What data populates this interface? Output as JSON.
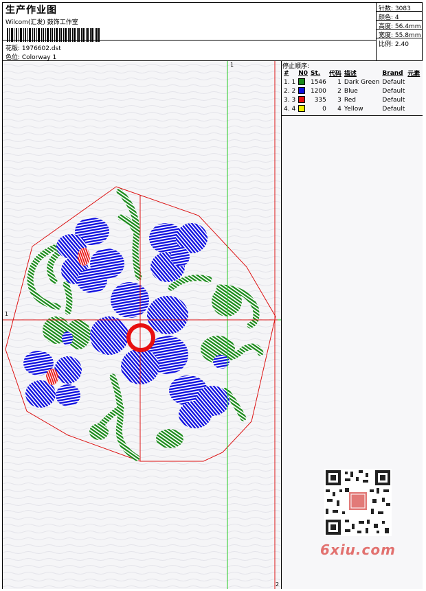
{
  "header": {
    "title": "生产作业图",
    "company": "Wilcom(汇发) 鼓饰工作室",
    "design_label": "花版: 1976602.dst",
    "colorway_label": "色位: Colorway 1"
  },
  "stats": [
    "针数: 3083",
    "颜色: 4",
    "高度: 56.4mm",
    "宽度: 55.8mm",
    "比例: 2.40"
  ],
  "stop_sequence": {
    "title": "停止顺序:",
    "columns": [
      "#",
      "N0",
      "St.",
      "代码",
      "描述",
      "Brand",
      "元素"
    ],
    "rows": [
      {
        "index": "1. 1",
        "color": "#1a8a1a",
        "stitches": "1546",
        "code": "1",
        "description": "Dark Green",
        "brand": "Default"
      },
      {
        "index": "2. 2",
        "color": "#1010e0",
        "stitches": "1200",
        "code": "2",
        "description": "Blue",
        "brand": "Default"
      },
      {
        "index": "3. 3",
        "color": "#e81010",
        "stitches": "335",
        "code": "3",
        "description": "Red",
        "brand": "Default"
      },
      {
        "index": "4. 4",
        "color": "#f0f000",
        "stitches": "0",
        "code": "4",
        "description": "Yellow",
        "brand": "Default"
      }
    ]
  },
  "guides": {
    "vertical_label": "1",
    "horizontal_label": "1",
    "vertical_red_label": "2"
  },
  "colors": {
    "guide_green": "#22cc22",
    "guide_red": "#dd1111",
    "stitch_green": "#1a8a1a",
    "stitch_blue": "#1010e0",
    "stitch_red": "#e81010",
    "watermark": "#e2716f"
  },
  "watermark": "6xiu.com"
}
